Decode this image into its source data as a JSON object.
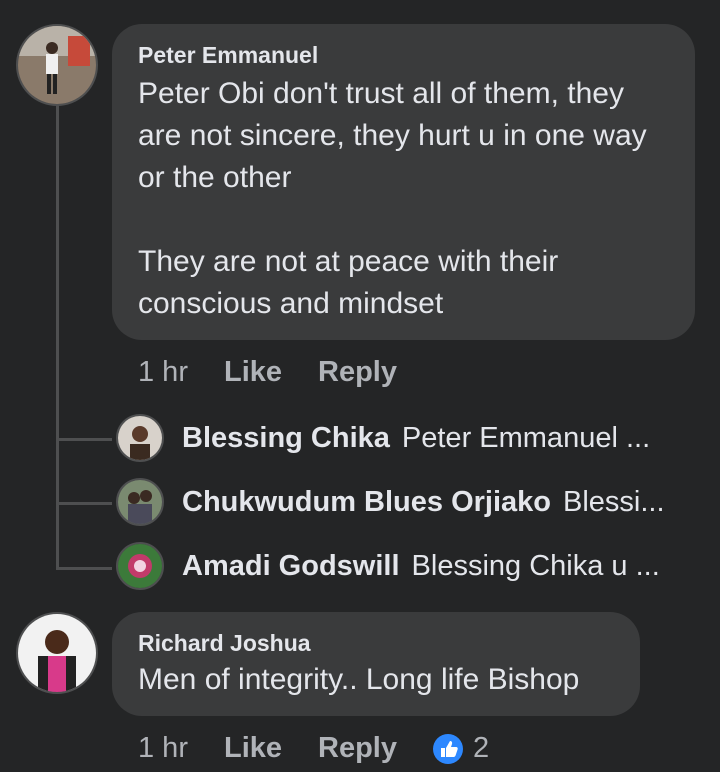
{
  "comments": [
    {
      "author": "Peter Emmanuel",
      "text": "Peter Obi don't trust all of them, they are not sincere, they hurt u in one way or the other\n\nThey are not at peace with their conscious and mindset",
      "time": "1 hr",
      "like_label": "Like",
      "reply_label": "Reply",
      "replies": [
        {
          "author": "Blessing Chika",
          "text": "Peter Emmanuel ..."
        },
        {
          "author": "Chukwudum Blues Orjiako",
          "text": "Blessi..."
        },
        {
          "author": "Amadi Godswill",
          "text": "Blessing Chika u ..."
        }
      ]
    },
    {
      "author": "Richard Joshua",
      "text": "Men of integrity.. Long life Bishop",
      "time": "1 hr",
      "like_label": "Like",
      "reply_label": "Reply",
      "reaction_count": "2"
    }
  ],
  "colors": {
    "background": "#242526",
    "bubble": "#3a3b3c",
    "meta_text": "#b0b3b8",
    "like_blue": "#2d88ff"
  }
}
